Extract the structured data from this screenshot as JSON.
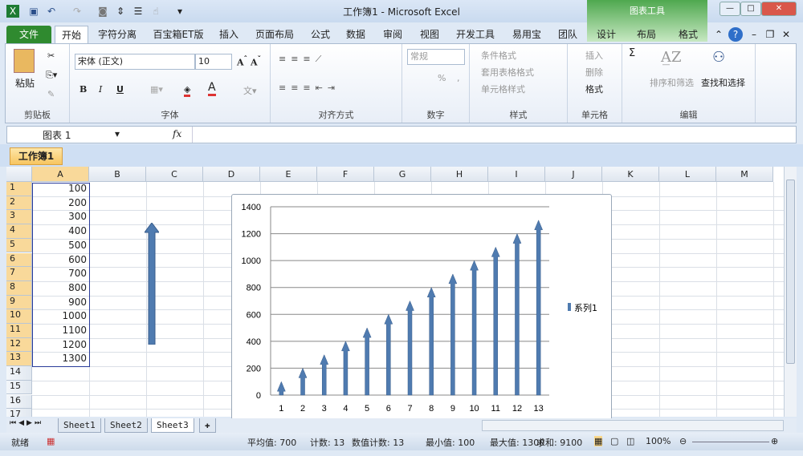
{
  "window": {
    "title": "工作簿1 - Microsoft Excel",
    "context_tab": "图表工具"
  },
  "tabs": [
    "文件",
    "开始",
    "字符分离",
    "百宝箱ET版",
    "插入",
    "页面布局",
    "公式",
    "数据",
    "审阅",
    "视图",
    "开发工具",
    "易用宝",
    "团队",
    "设计",
    "布局",
    "格式"
  ],
  "ribbon": {
    "clipboard": {
      "paste": "粘贴",
      "label": "剪贴板"
    },
    "font": {
      "name": "宋体 (正文)",
      "size": "10",
      "bold": "B",
      "italic": "I",
      "underline": "U",
      "label": "字体"
    },
    "align": {
      "label": "对齐方式"
    },
    "number": {
      "format": "常规",
      "percent": "%",
      "comma": ",",
      "label": "数字"
    },
    "styles": {
      "cond": "条件格式",
      "table": "套用表格格式",
      "cell": "单元格样式",
      "label": "样式"
    },
    "cells": {
      "insert": "插入",
      "delete": "删除",
      "format": "格式",
      "label": "单元格"
    },
    "editing": {
      "sum": "Σ",
      "sort": "排序和筛选",
      "find": "查找和选择",
      "label": "编辑"
    }
  },
  "formula_bar": {
    "name_box": "图表 1",
    "fx": "fx",
    "value": ""
  },
  "workbook_tab": "工作簿1",
  "columns": [
    "A",
    "B",
    "C",
    "D",
    "E",
    "F",
    "G",
    "H",
    "I",
    "J",
    "K",
    "L",
    "M"
  ],
  "rows": [
    "1",
    "2",
    "3",
    "4",
    "5",
    "6",
    "7",
    "8",
    "9",
    "10",
    "11",
    "12",
    "13",
    "14",
    "15",
    "16",
    "17"
  ],
  "cells_A": [
    "100",
    "200",
    "300",
    "400",
    "500",
    "600",
    "700",
    "800",
    "900",
    "1000",
    "1100",
    "1200",
    "1300"
  ],
  "sheets": [
    "Sheet1",
    "Sheet2",
    "Sheet3"
  ],
  "status": {
    "ready": "就绪",
    "avg": "平均值: 700",
    "count": "计数: 13",
    "numcount": "数值计数: 13",
    "min": "最小值: 100",
    "max": "最大值: 1300",
    "sum": "求和: 9100",
    "zoom": "100%"
  },
  "chart_data": {
    "type": "bar",
    "categories": [
      "1",
      "2",
      "3",
      "4",
      "5",
      "6",
      "7",
      "8",
      "9",
      "10",
      "11",
      "12",
      "13"
    ],
    "series": [
      {
        "name": "系列1",
        "values": [
          100,
          200,
          300,
          400,
          500,
          600,
          700,
          800,
          900,
          1000,
          1100,
          1200,
          1300
        ]
      }
    ],
    "ylim": [
      0,
      1400
    ],
    "yticks": [
      "0",
      "200",
      "400",
      "600",
      "800",
      "1000",
      "1200",
      "1400"
    ],
    "legend": "right",
    "grid": true,
    "color": "#4f7bb0"
  }
}
